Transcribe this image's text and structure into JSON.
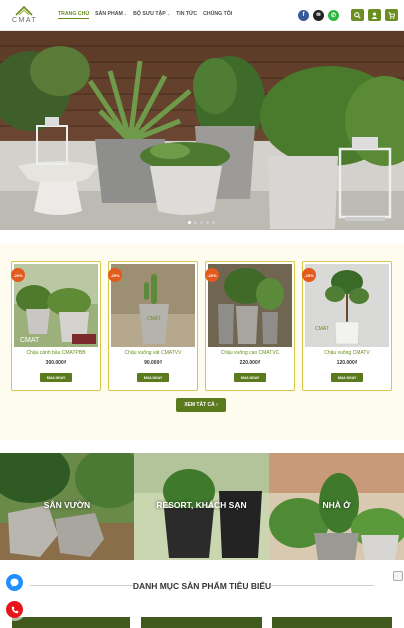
{
  "header": {
    "logo_text": "CMAT",
    "nav": [
      {
        "label": "TRANG CHỦ",
        "active": true,
        "has_caret": false
      },
      {
        "label": "SẢN PHẨM",
        "active": false,
        "has_caret": true
      },
      {
        "label": "BỘ SƯU TẬP",
        "active": false,
        "has_caret": true
      },
      {
        "label": "TIN TỨC",
        "active": false,
        "has_caret": false
      },
      {
        "label": "CHÚNG TÔI",
        "active": false,
        "has_caret": false
      }
    ],
    "icons": {
      "facebook": "f",
      "email": "✉",
      "phone": "✆",
      "search": "⌕",
      "account": "👤",
      "cart": "🛒"
    },
    "colors": {
      "accent": "#6b8e23",
      "facebook": "#3b5998",
      "email": "#222222",
      "phone": "#2db742"
    }
  },
  "hero": {
    "slides": 5,
    "active_slide": 0
  },
  "products": [
    {
      "name": "Chậu cảnh bầu CMATPBB",
      "price": "300.000₫",
      "button": "MUA NGAY",
      "badge": "-20%"
    },
    {
      "name": "Chậu vuông vát CMATVV",
      "price": "90.000₫",
      "button": "MUA NGAY",
      "badge": "-20%"
    },
    {
      "name": "Chậu vuông cao CMATVC",
      "price": "220.000₫",
      "button": "MUA NGAY",
      "badge": "-20%"
    },
    {
      "name": "Chậu vuông CMATV",
      "price": "120.000₫",
      "button": "MUA NGAY",
      "badge": "-25%"
    }
  ],
  "view_all": {
    "label": "XEM TẤT CẢ",
    "arrow": "›"
  },
  "categories": [
    {
      "label": "SÂN VƯỜN"
    },
    {
      "label": "RESORT, KHÁCH SẠN"
    },
    {
      "label": "NHÀ Ở"
    }
  ],
  "featured": {
    "title": "DANH MỤC SẢN PHẨM TIÊU BIỂU"
  },
  "floating": {
    "messenger_color": "#1e90ff",
    "call_color": "#e8141b"
  }
}
